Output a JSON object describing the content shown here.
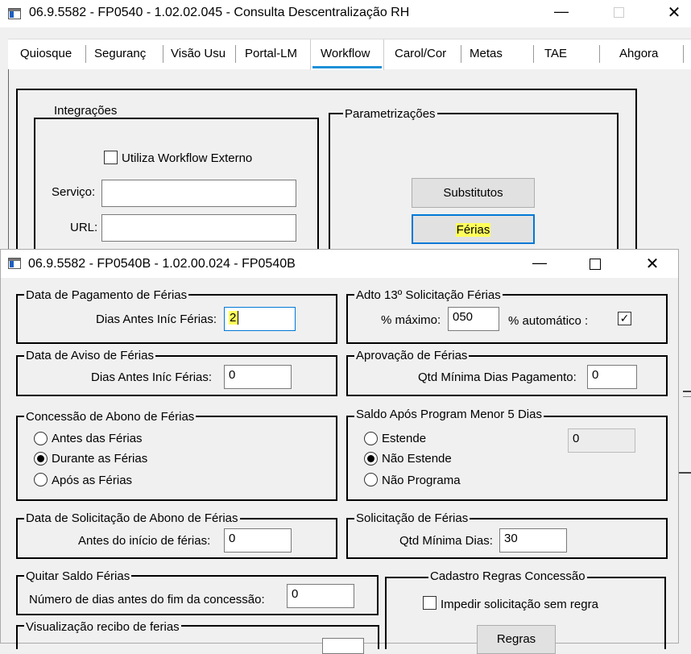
{
  "back_window": {
    "title": "06.9.5582 - FP0540 - 1.02.02.045 - Consulta Descentralização RH",
    "tabs": [
      "Quiosque",
      "Seguranç",
      "Visão Usu",
      "Portal-LM",
      "Workflow",
      "Carol/Cor",
      "Metas",
      "TAE",
      "Ahgora"
    ],
    "active_tab": "Workflow",
    "integracoes": {
      "legend": "Integrações",
      "use_external_label": "Utiliza Workflow Externo",
      "service_label": "Serviço:",
      "service_value": "",
      "url_label": "URL:",
      "url_value": ""
    },
    "parametrizacoes": {
      "legend": "Parametrizações",
      "substitutos_button": "Substitutos",
      "ferias_button": "Férias"
    }
  },
  "front_window": {
    "title": "06.9.5582 - FP0540B - 1.02.00.024 - FP0540B",
    "pagamento": {
      "legend": "Data de Pagamento de Férias",
      "label": "Dias Antes Iníc Férias:",
      "value": "2"
    },
    "adto13": {
      "legend": "Adto 13º Solicitação Férias",
      "max_label": "% máximo:",
      "max_value": "050",
      "auto_label": "% automático :",
      "auto_checked": true
    },
    "aviso": {
      "legend": "Data de Aviso de Férias",
      "label": "Dias Antes Iníc Férias:",
      "value": "0"
    },
    "aprovacao": {
      "legend": "Aprovação de Férias",
      "label": "Qtd Mínima Dias Pagamento:",
      "value": "0"
    },
    "abono": {
      "legend": "Concessão de Abono de Férias",
      "options": [
        "Antes das Férias",
        "Durante as Férias",
        "Após as Férias"
      ],
      "selected": 1
    },
    "saldo": {
      "legend": "Saldo Após Program Menor 5 Dias",
      "options": [
        "Estende",
        "Não Estende",
        "Não Programa"
      ],
      "selected": 1,
      "value": "0"
    },
    "solic_abono": {
      "legend": "Data de Solicitação de Abono de Férias",
      "label": "Antes do início de férias:",
      "value": "0"
    },
    "solic_ferias": {
      "legend": "Solicitação de Férias",
      "label": "Qtd Mínima Dias:",
      "value": "30"
    },
    "quitar": {
      "legend": "Quitar Saldo Férias",
      "label": "Número de dias antes do fim da concessão:",
      "value": "0"
    },
    "cadastro": {
      "legend": "Cadastro Regras Concessão",
      "checkbox_label": "Impedir solicitação sem regra",
      "regras_button": "Regras"
    },
    "recibo": {
      "legend": "Visualização recibo de ferias"
    }
  }
}
